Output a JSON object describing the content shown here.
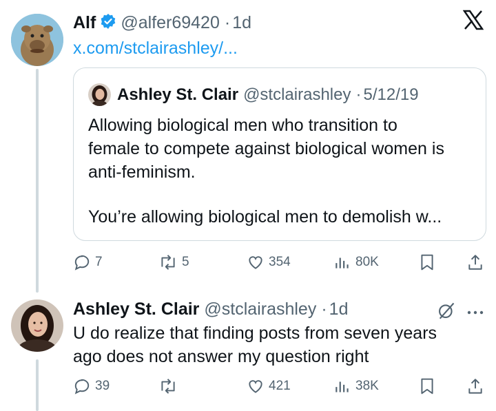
{
  "tweet1": {
    "name": "Alf",
    "handle": "@alfer69420",
    "dot": "·",
    "time": "1d",
    "link": "x.com/stclairashley/...",
    "verified_color": "#1d9bf0",
    "quote": {
      "name": "Ashley St. Clair",
      "handle": "@stclairashley",
      "dot": "·",
      "date": "5/12/19",
      "line1": "Allowing biological men who transition to",
      "line2": "female to compete against biological women is",
      "line3": "anti-feminism.",
      "line4": "You’re allowing biological men to demolish w..."
    },
    "actions": {
      "replies": "7",
      "reposts": "5",
      "likes": "354",
      "views": "80K"
    }
  },
  "tweet2": {
    "name": "Ashley St. Clair",
    "handle": "@stclairashley",
    "dot": "·",
    "time": "1d",
    "line1": "U do realize that finding posts from seven years",
    "line2": "ago does not answer my question right",
    "actions": {
      "replies": "39",
      "reposts": "",
      "likes": "421",
      "views": "38K"
    }
  },
  "icons": {
    "x_logo": "x-logo",
    "more": "more-icon"
  }
}
